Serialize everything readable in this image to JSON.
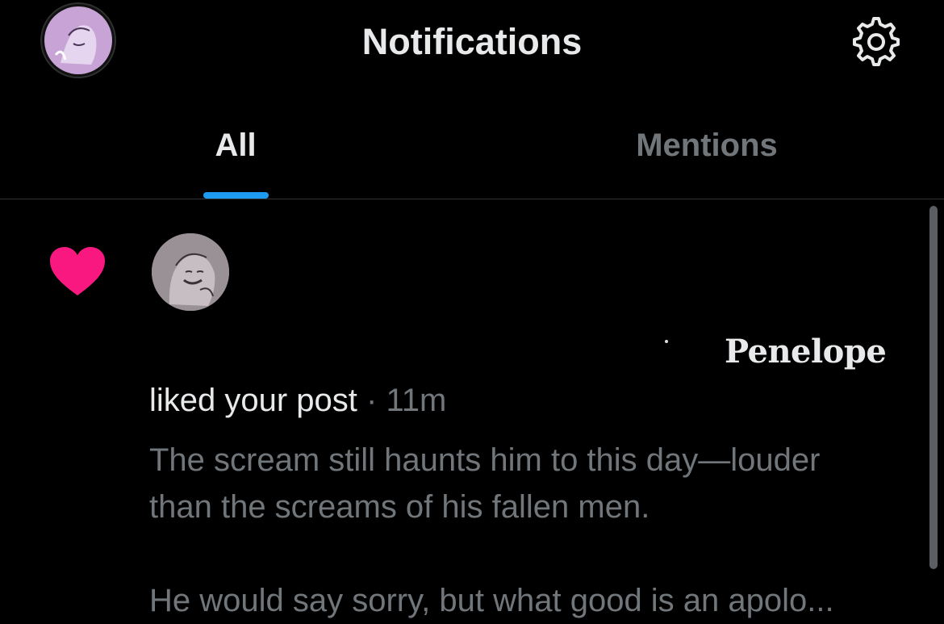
{
  "header": {
    "title": "Notifications",
    "my_avatar_icon": "profile-avatar",
    "settings_icon": "gear-icon"
  },
  "tabs": [
    {
      "label": "All",
      "active": true
    },
    {
      "label": "Mentions",
      "active": false
    }
  ],
  "notification": {
    "type_icon": "heart-icon",
    "type_color": "#f91880",
    "liker_avatar_icon": "user-avatar",
    "watermark_dot": "·",
    "signature": "Penelope",
    "action_text": "liked your post",
    "separator": "·",
    "time": "11m",
    "post_lines": [
      "The scream still haunts him to this day—louder",
      "than the screams of his fallen men.",
      "He would say sorry, but what good is an apolo..."
    ]
  },
  "colors": {
    "background": "#000000",
    "accent": "#1d9bf0",
    "heart": "#f91880",
    "primary_text": "#e7e9ea",
    "secondary_text": "#71767b"
  }
}
